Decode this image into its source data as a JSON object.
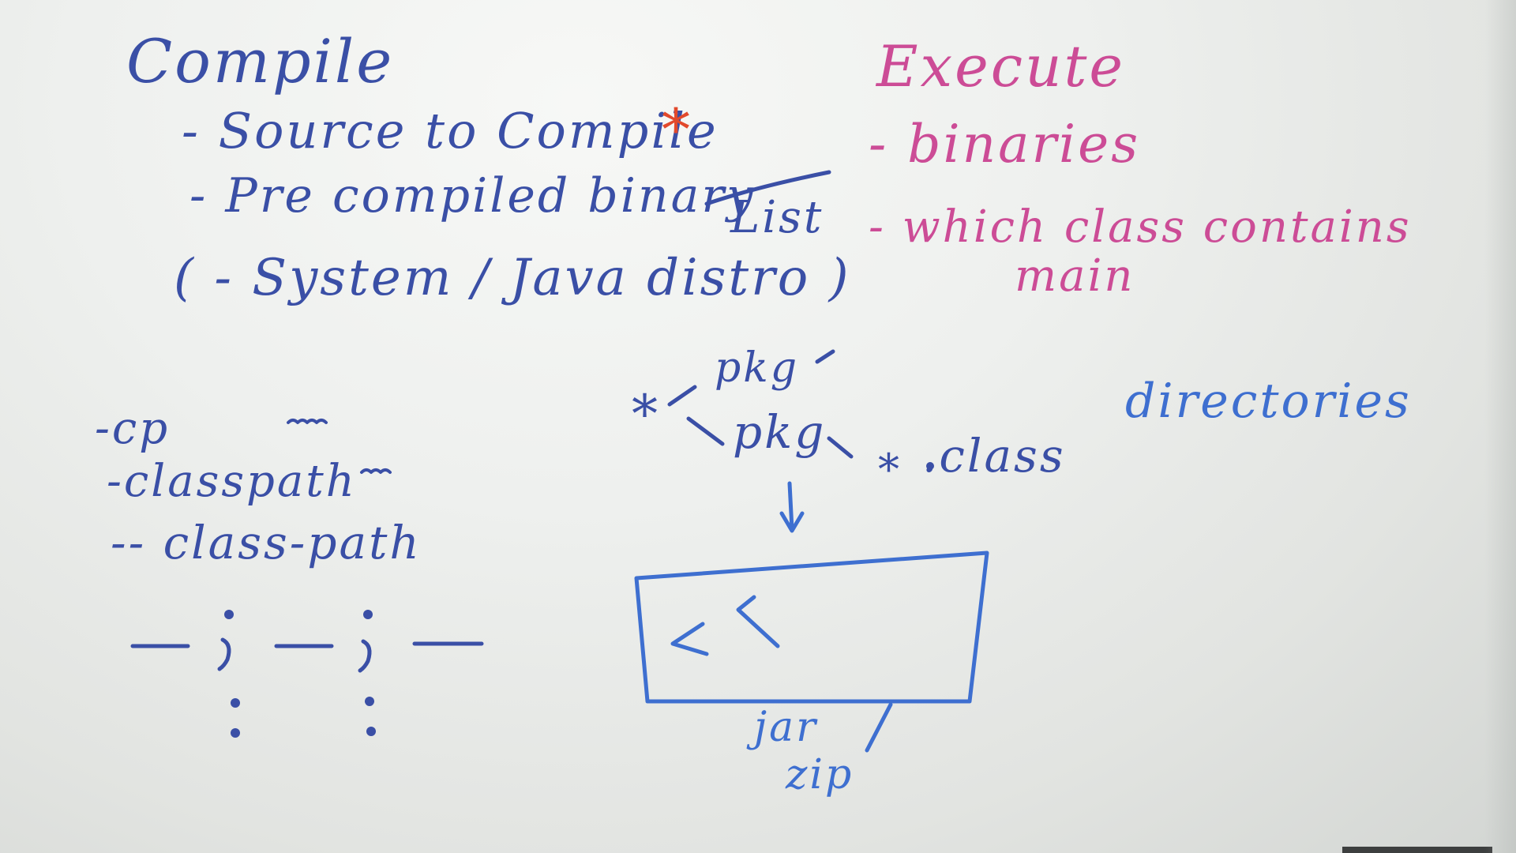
{
  "compile": {
    "heading": "Compile",
    "item_source": "- Source to Compile",
    "item_source_mark": "*",
    "item_binary": "- Pre compiled binary",
    "item_system": "( - System / Java distro )"
  },
  "link_label": "List",
  "execute": {
    "heading": "Execute",
    "item_binaries": "- binaries",
    "item_main_line1": "- which class contains",
    "item_main_line2": "main"
  },
  "options": {
    "cp": "-cp",
    "classpath": "-classpath",
    "class_path": "-- class-path"
  },
  "package_tree": {
    "pkg_upper": "pkg",
    "pkg_lower": "pkg",
    "star_left": "*",
    "star_class": "*",
    "class_label": ".class",
    "directories": "directories"
  },
  "archive": {
    "label_jar": "jar",
    "label_zip": "zip"
  },
  "colors": {
    "blue_marker": "#3a4fa6",
    "bright_blue_marker": "#3e6fd0",
    "pink_marker": "#cc4c96",
    "orange_marker": "#e2492c",
    "board": "#eef0ee"
  }
}
